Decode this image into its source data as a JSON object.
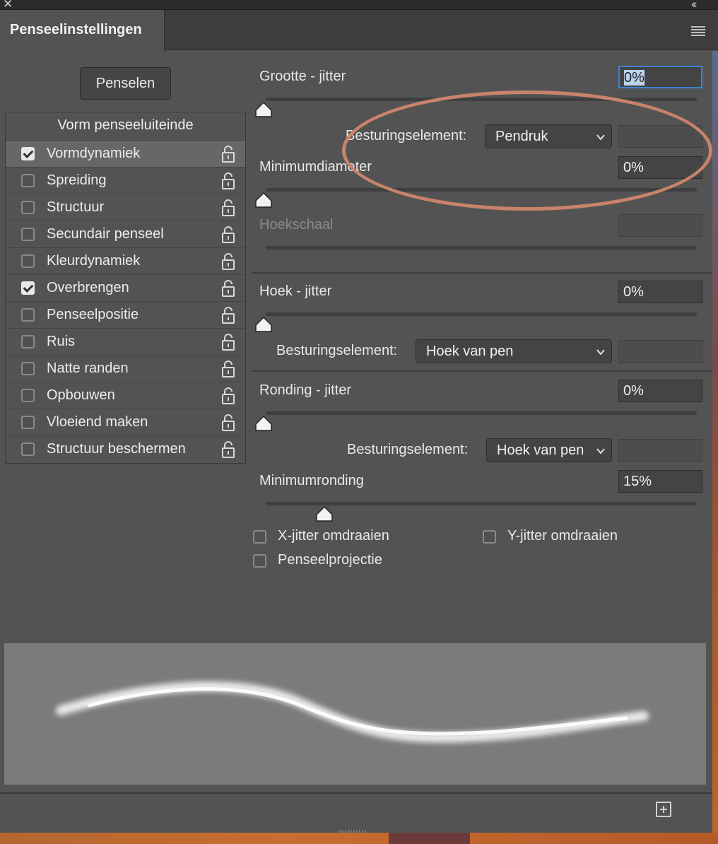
{
  "panel": {
    "title": "Penseelinstellingen",
    "penselen_button": "Penselen"
  },
  "left_list": {
    "header": "Vorm penseeluiteinde",
    "items": [
      {
        "label": "Vormdynamiek",
        "checked": true,
        "selected": true
      },
      {
        "label": "Spreiding",
        "checked": false
      },
      {
        "label": "Structuur",
        "checked": false
      },
      {
        "label": "Secundair penseel",
        "checked": false
      },
      {
        "label": "Kleurdynamiek",
        "checked": false
      },
      {
        "label": "Overbrengen",
        "checked": true
      },
      {
        "label": "Penseelpositie",
        "checked": false
      },
      {
        "label": "Ruis",
        "checked": false
      },
      {
        "label": "Natte randen",
        "checked": false
      },
      {
        "label": "Opbouwen",
        "checked": false
      },
      {
        "label": "Vloeiend maken",
        "checked": false
      },
      {
        "label": "Structuur beschermen",
        "checked": false
      }
    ]
  },
  "settings": {
    "size_jitter": {
      "label": "Grootte - jitter",
      "value": "0%",
      "level": 0
    },
    "size_control": {
      "label": "Besturingselement:",
      "value": "Pendruk"
    },
    "min_diameter": {
      "label": "Minimumdiameter",
      "value": "0%",
      "level": 0
    },
    "tilt_scale": {
      "label": "Hoekschaal",
      "value": ""
    },
    "angle_jitter": {
      "label": "Hoek - jitter",
      "value": "0%",
      "level": 0
    },
    "angle_control": {
      "label": "Besturingselement:",
      "value": "Hoek van pen"
    },
    "roundness_jitter": {
      "label": "Ronding - jitter",
      "value": "0%",
      "level": 0
    },
    "roundness_control": {
      "label": "Besturingselement:",
      "value": "Hoek van pen"
    },
    "min_roundness": {
      "label": "Minimumronding",
      "value": "15%",
      "level": 0.15
    },
    "flip_x": {
      "label": "X-jitter omdraaien",
      "checked": false
    },
    "flip_y": {
      "label": "Y-jitter omdraaien",
      "checked": false
    },
    "brush_projection": {
      "label": "Penseelprojectie",
      "checked": false
    }
  },
  "icons": {
    "close": "close-icon",
    "collapse": "double-chevron-icon",
    "menu": "hamburger-menu-icon",
    "lock": "unlocked-padlock-icon",
    "new_preset": "plus-square-icon"
  },
  "colors": {
    "panel_bg": "#535353",
    "focus_ring": "#3d82d6",
    "annotation": "#c8846a",
    "preview_bg": "#7b7b7b"
  }
}
